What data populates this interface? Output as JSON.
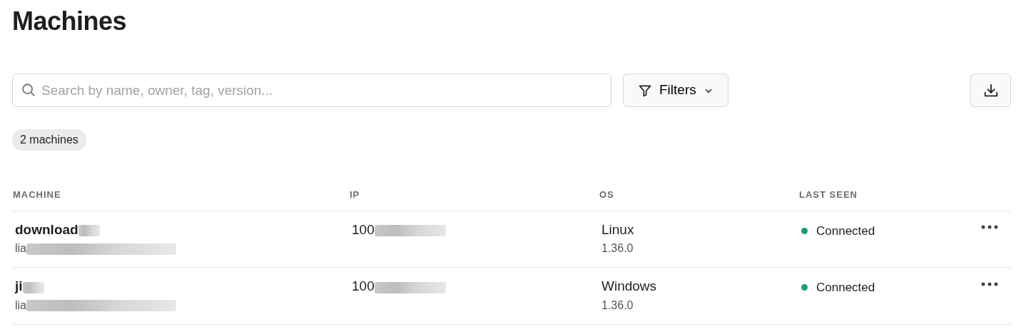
{
  "title": "Machines",
  "search": {
    "placeholder": "Search by name, owner, tag, version..."
  },
  "filters_button": {
    "label": "Filters"
  },
  "count_badge": "2 machines",
  "table": {
    "columns": [
      "MACHINE",
      "IP",
      "OS",
      "LAST SEEN"
    ],
    "rows": [
      {
        "name": "download",
        "owner": "lia",
        "ip": "100",
        "os": "Linux",
        "version": "1.36.0",
        "status": "Connected",
        "color": "#1f9d6b",
        "redacted": true
      },
      {
        "name": "ji",
        "owner": "lia",
        "ip": "100",
        "os": "Windows",
        "version": "1.36.0",
        "status": "Connected",
        "color": "#1f9d6b",
        "redacted": true
      }
    ]
  }
}
